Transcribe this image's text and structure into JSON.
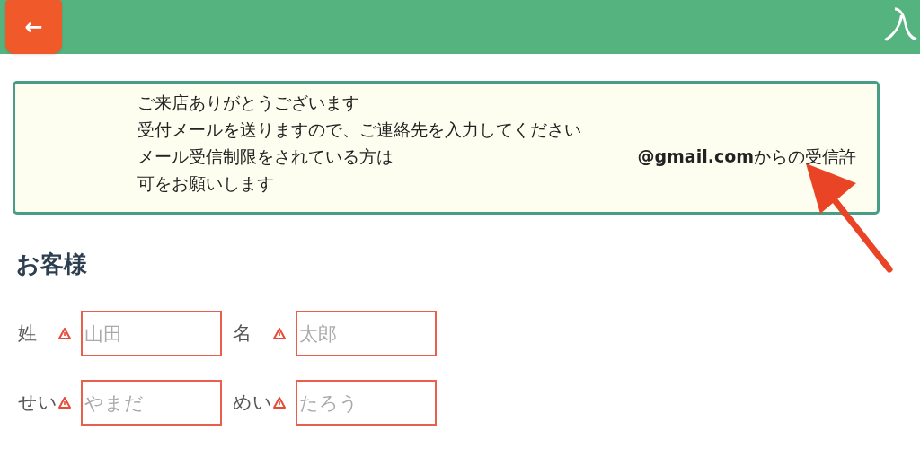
{
  "header": {
    "back_button": "←",
    "title": "入"
  },
  "notice": {
    "lines": [
      "ご来店ありがとうございます",
      "受付メールを送りますので、ご連絡先を入力してください"
    ],
    "line3_left": "メール受信制限をされている方は",
    "line3_right": "**@gmail.com**からの受信許",
    "line4": "可をお願いします"
  },
  "section_title": "お客様",
  "fields": [
    {
      "label": "姓",
      "placeholder": "山田",
      "error": true
    },
    {
      "label": "名",
      "placeholder": "太郎",
      "error": true
    },
    {
      "label": "せい",
      "placeholder": "やまだ",
      "error": true
    },
    {
      "label": "めい",
      "placeholder": "たろう",
      "error": true
    }
  ]
}
